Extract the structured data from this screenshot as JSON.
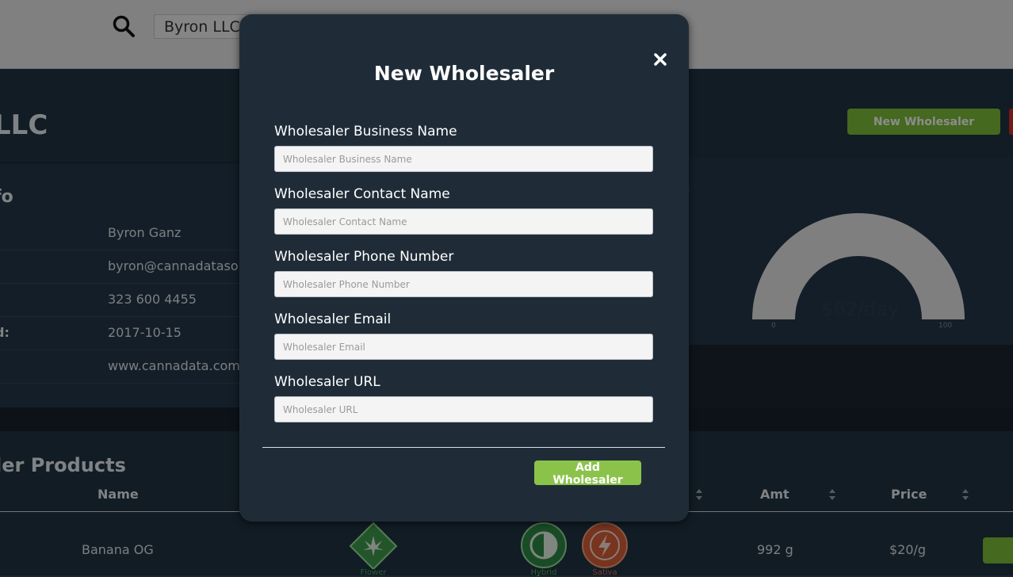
{
  "search": {
    "value": "Byron LLC"
  },
  "header": {
    "title_fragment": "LLC",
    "new_wholesaler_label": "New Wholesaler"
  },
  "info": {
    "title_fragment": "fo",
    "rows": [
      {
        "label": "",
        "value": "Byron Ganz"
      },
      {
        "label": "",
        "value": "byron@cannadatasolu"
      },
      {
        "label": "",
        "value": "323 600 4455"
      },
      {
        "label": "d:",
        "value": "2017-10-15"
      },
      {
        "label": "",
        "value": "www.cannadata.com"
      }
    ]
  },
  "gauge": {
    "heading_fragment": "t",
    "value_label": "$62/day",
    "min_label": "0",
    "max_label": "100",
    "level_fraction": 0.62
  },
  "products": {
    "title_fragment": "ler Products",
    "columns": [
      "Name",
      "Amt",
      "Price"
    ],
    "rows": [
      {
        "name": "Banana OG",
        "type": "Flower",
        "strains": [
          "Hybrid",
          "Sativa"
        ],
        "amount": "992 g",
        "price": "$20/g"
      }
    ]
  },
  "modal": {
    "title": "New Wholesaler",
    "close_icon": "close-icon",
    "fields": [
      {
        "label": "Wholesaler Business Name",
        "placeholder": "Wholesaler Business Name",
        "value": ""
      },
      {
        "label": "Wholesaler Contact Name",
        "placeholder": "Wholesaler Contact Name",
        "value": ""
      },
      {
        "label": "Wholesaler Phone Number",
        "placeholder": "Wholesaler Phone Number",
        "value": ""
      },
      {
        "label": "Wholesaler Email",
        "placeholder": "Wholesaler Email",
        "value": ""
      },
      {
        "label": "Wholesaler URL",
        "placeholder": "Wholesaler URL",
        "value": ""
      }
    ],
    "submit_label": "Add Wholesaler"
  },
  "colors": {
    "accent": "#8bc34a",
    "modal_bg": "#1f2c38",
    "panel_bg": "#24384a"
  }
}
